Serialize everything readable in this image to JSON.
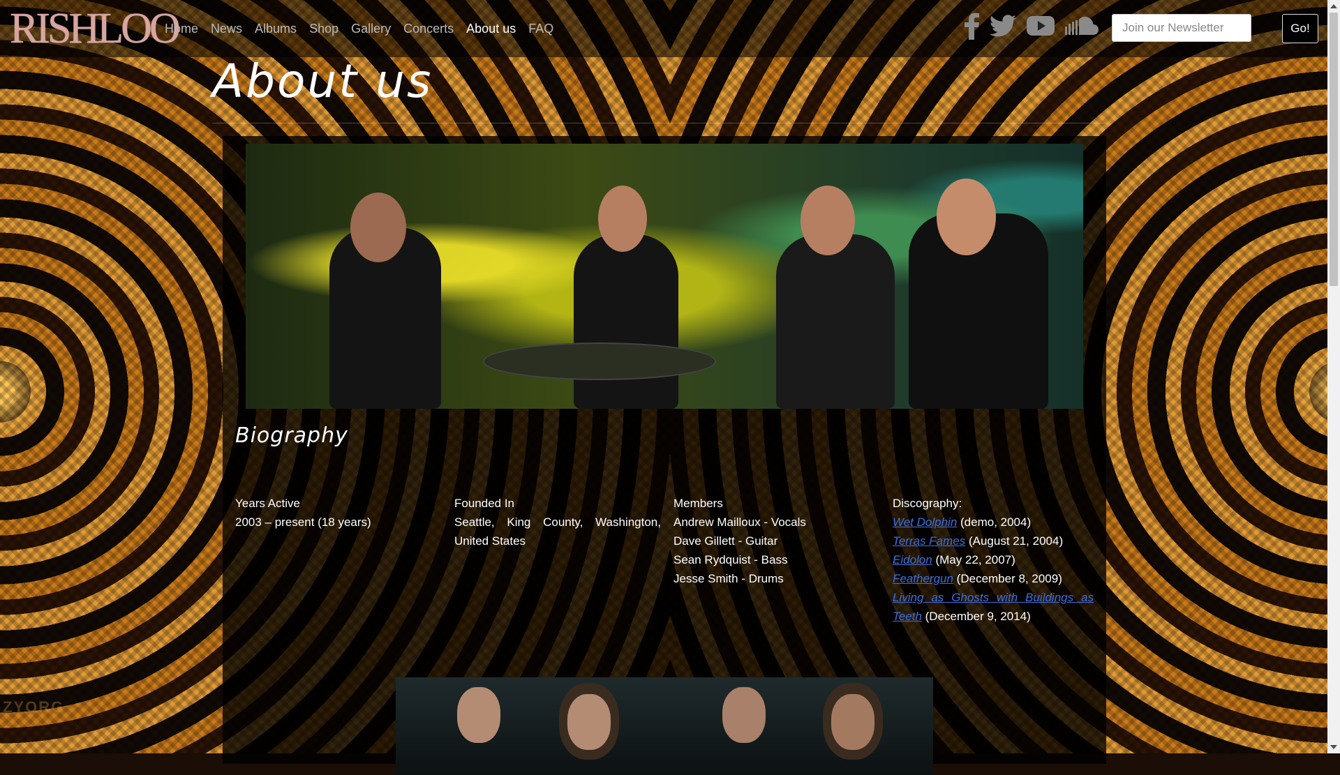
{
  "brand": {
    "logo_text": "RISHLOO"
  },
  "nav": {
    "items": [
      {
        "label": "Home",
        "active": false
      },
      {
        "label": "News",
        "active": false
      },
      {
        "label": "Albums",
        "active": false
      },
      {
        "label": "Shop",
        "active": false
      },
      {
        "label": "Gallery",
        "active": false
      },
      {
        "label": "Concerts",
        "active": false
      },
      {
        "label": "About us",
        "active": true
      },
      {
        "label": "FAQ",
        "active": false
      }
    ]
  },
  "social": [
    "facebook-icon",
    "twitter-icon",
    "youtube-icon",
    "soundcloud-icon"
  ],
  "newsletter": {
    "placeholder": "Join our Newsletter",
    "button_label": "Go!"
  },
  "page": {
    "title": "About us"
  },
  "biography": {
    "heading": "Biography",
    "years_active": {
      "label": "Years Active",
      "value": "2003 – present (18 years)"
    },
    "founded_in": {
      "label": "Founded In",
      "value": "Seattle, King County, Washington, United States"
    },
    "members": {
      "label": "Members",
      "list": [
        "Andrew Mailloux - Vocals",
        "Dave Gillett - Guitar",
        "Sean Rydquist - Bass",
        "Jesse Smith - Drums"
      ]
    },
    "discography": {
      "label": "Discography:",
      "items": [
        {
          "title": "Wet Dolphin",
          "detail": " (demo, 2004)"
        },
        {
          "title": "Terras Fames",
          "detail": " (August 21, 2004)"
        },
        {
          "title": "Eidolon",
          "detail": " (May 22, 2007)"
        },
        {
          "title": "Feathergun",
          "detail": " (December 8, 2009)"
        },
        {
          "title": "Living as Ghosts with Buildings as Teeth",
          "detail": " (December 9, 2014)"
        }
      ]
    }
  },
  "watermark": "ZYORG",
  "colors": {
    "link": "#3d6fe0",
    "nav_active": "#ffffff",
    "nav_inactive": "#bbbbbb",
    "logo": "#d9a4a0"
  }
}
